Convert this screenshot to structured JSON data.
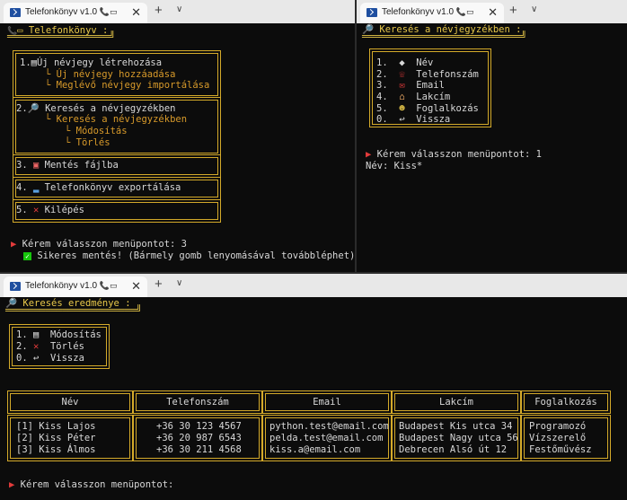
{
  "tab_title": "Telefonkönyv v1.0",
  "win1": {
    "header": "Telefonkönyv :",
    "menu": [
      {
        "num": "1.",
        "label": "Új névjegy létrehozása",
        "subs": [
          "└ Új névjegy hozzáadása",
          "└ Meglévő névjegy importálása"
        ]
      },
      {
        "num": "2.",
        "label": "Keresés a névjegyzékben",
        "subs": [
          "└ Keresés a névjegyzékben",
          "└ Módosítás",
          "└ Törlés"
        ]
      },
      {
        "num": "3.",
        "label": "Mentés fájlba"
      },
      {
        "num": "4.",
        "label": "Telefonkönyv exportálása"
      },
      {
        "num": "5.",
        "label": "Kilépés"
      }
    ],
    "prompt": "Kérem válasszon menüpontot: 3",
    "success": "Sikeres mentés! (Bármely gomb lenyomásával továbbléphet)"
  },
  "win2": {
    "header": "Keresés a névjegyzékben :",
    "menu": [
      {
        "num": "1.",
        "label": "Név"
      },
      {
        "num": "2.",
        "label": "Telefonszám"
      },
      {
        "num": "3.",
        "label": "Email"
      },
      {
        "num": "4.",
        "label": "Lakcím"
      },
      {
        "num": "5.",
        "label": "Foglalkozás"
      },
      {
        "num": "0.",
        "label": "Vissza"
      }
    ],
    "prompt": "Kérem válasszon menüpontot: 1",
    "input": "Név: Kiss*"
  },
  "win3": {
    "header": "Keresés eredménye :",
    "menu": [
      {
        "num": "1.",
        "label": "Módosítás"
      },
      {
        "num": "2.",
        "label": "Törlés"
      },
      {
        "num": "0.",
        "label": "Vissza"
      }
    ],
    "table": {
      "columns": [
        "Név",
        "Telefonszám",
        "Email",
        "Lakcím",
        "Foglalkozás"
      ],
      "rows": [
        [
          "[1] Kiss Lajos",
          "+36 30 123 4567",
          "python.test@email.com",
          "Budapest Kis utca 34",
          "Programozó"
        ],
        [
          "[2] Kiss Péter",
          "+36 20 987 6543",
          "pelda.test@email.com",
          "Budapest Nagy utca 56",
          "Vízszerelő"
        ],
        [
          "[3] Kiss Álmos",
          "+36 30 211 4568",
          "kiss.a@email.com",
          "Debrecen Alsó út 12",
          "Festőművész"
        ]
      ]
    },
    "prompt": "Kérem válasszon menüpontot:"
  },
  "colors": {
    "gold": "#d4aa2a",
    "terminal_bg": "#0c0c0c",
    "accent_red": "#e23b3b"
  }
}
